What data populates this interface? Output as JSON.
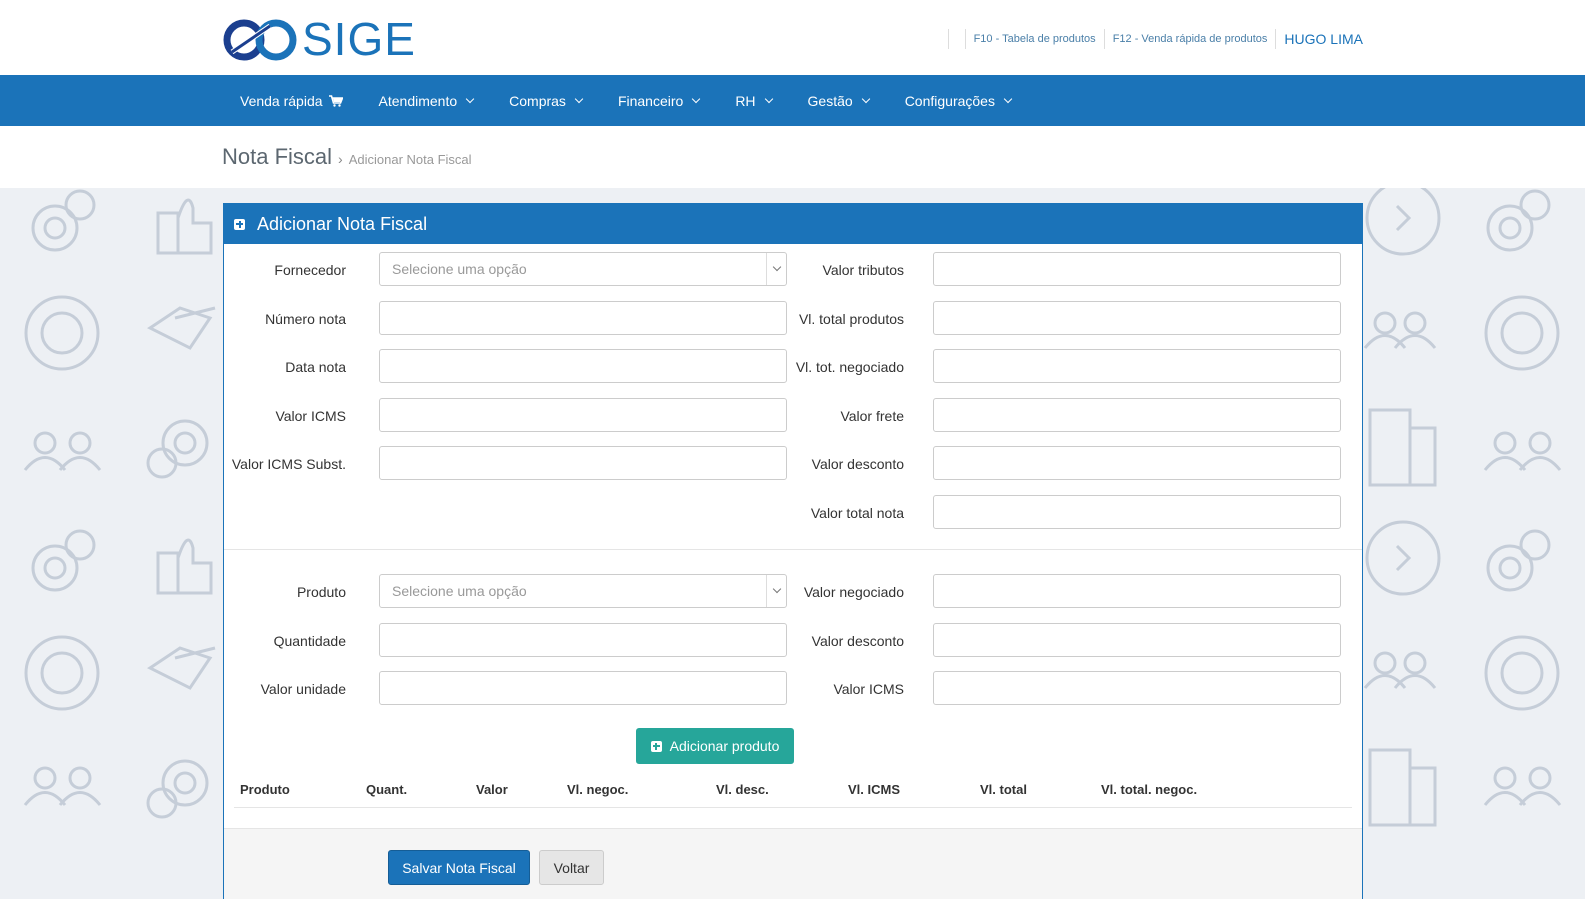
{
  "header": {
    "logo_text": "SIGE",
    "links": [
      {
        "label": "F10 - Tabela de produtos"
      },
      {
        "label": "F12 - Venda rápida de produtos"
      }
    ],
    "user": "HUGO LIMA"
  },
  "nav": {
    "items": [
      {
        "label": "Venda rápida",
        "icon": "cart-icon"
      },
      {
        "label": "Atendimento",
        "icon": "chevron-down-icon"
      },
      {
        "label": "Compras",
        "icon": "chevron-down-icon"
      },
      {
        "label": "Financeiro",
        "icon": "chevron-down-icon"
      },
      {
        "label": "RH",
        "icon": "chevron-down-icon"
      },
      {
        "label": "Gestão",
        "icon": "chevron-down-icon"
      },
      {
        "label": "Configurações",
        "icon": "chevron-down-icon"
      }
    ]
  },
  "breadcrumb": {
    "title": "Nota Fiscal",
    "separator": "›",
    "current": "Adicionar Nota Fiscal"
  },
  "panel": {
    "title": "Adicionar Nota Fiscal",
    "invoice_fields": {
      "fornecedor": {
        "label": "Fornecedor",
        "placeholder": "Selecione uma opção"
      },
      "numero_nota": {
        "label": "Número nota",
        "value": ""
      },
      "data_nota": {
        "label": "Data nota",
        "value": ""
      },
      "valor_icms": {
        "label": "Valor ICMS",
        "value": ""
      },
      "valor_icms_subst": {
        "label": "Valor ICMS Subst.",
        "value": ""
      },
      "valor_tributos": {
        "label": "Valor tributos",
        "value": ""
      },
      "vl_total_produtos": {
        "label": "Vl. total produtos",
        "value": ""
      },
      "vl_tot_negociado": {
        "label": "Vl. tot. negociado",
        "value": ""
      },
      "valor_frete": {
        "label": "Valor frete",
        "value": ""
      },
      "valor_desconto": {
        "label": "Valor desconto",
        "value": ""
      },
      "valor_total_nota": {
        "label": "Valor total nota",
        "value": ""
      }
    },
    "product_fields": {
      "produto": {
        "label": "Produto",
        "placeholder": "Selecione uma opção"
      },
      "quantidade": {
        "label": "Quantidade",
        "value": ""
      },
      "valor_unidade": {
        "label": "Valor unidade",
        "value": ""
      },
      "valor_negociado": {
        "label": "Valor negociado",
        "value": ""
      },
      "valor_desconto": {
        "label": "Valor desconto",
        "value": ""
      },
      "valor_icms": {
        "label": "Valor ICMS",
        "value": ""
      }
    },
    "add_product_button": "Adicionar produto",
    "table": {
      "columns": [
        "Produto",
        "Quant.",
        "Valor",
        "Vl. negoc.",
        "Vl. desc.",
        "Vl. ICMS",
        "Vl. total",
        "Vl. total. negoc."
      ],
      "rows": []
    },
    "actions": {
      "save": "Salvar Nota Fiscal",
      "back": "Voltar"
    }
  },
  "colors": {
    "primary": "#1b73b9",
    "success": "#26a69a",
    "background": "#edf0f4"
  }
}
